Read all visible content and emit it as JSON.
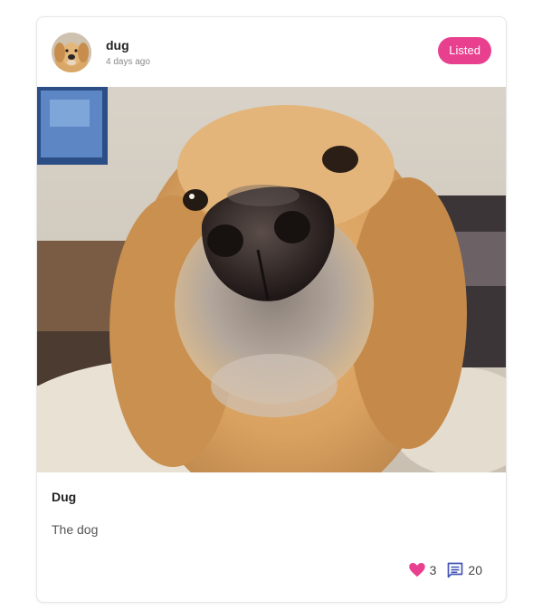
{
  "post": {
    "author": {
      "name": "dug",
      "avatar": "golden-retriever-avatar"
    },
    "time_ago": "4 days ago",
    "status": "Listed",
    "image": "golden-retriever-nose-closeup-photo",
    "title": "Dug",
    "description": "The dog",
    "likes": "3",
    "comments": "20"
  },
  "icons": {
    "like": "heart-icon",
    "comment": "comment-icon"
  },
  "colors": {
    "accent_pink": "#e8408f",
    "comment_icon": "#3f51b5",
    "text_dark": "#222222",
    "text_muted": "#8a8a8a"
  }
}
